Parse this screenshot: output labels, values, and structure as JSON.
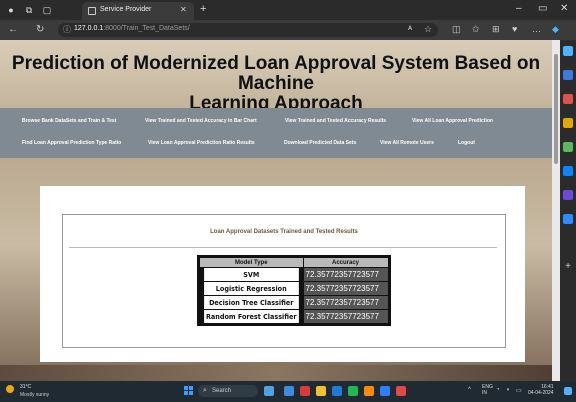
{
  "browser": {
    "tab_title": "Service Provider",
    "url_host": "127.0.0.1",
    "url_path": ":8000/Train_Test_DataSets/"
  },
  "site": {
    "title_line1": "Prediction of Modernized Loan Approval System Based on Machine",
    "title_line2": "Learning Approach"
  },
  "menu": {
    "row1": [
      "Browse Bank DataSets and Train & Test",
      "View Trained and Tested Accuracy in Bar Chart",
      "View Trained and Tested Accuracy Results",
      "View All Loan Approval Prediction"
    ],
    "row2": [
      "Find Loan Approval Prediction Type Ratio",
      "View Loan Approval Prediction Ratio Results",
      "Download Predicted Data Sets",
      "View All Remote Users",
      "Logout"
    ]
  },
  "panel": {
    "title": "Loan Approval Datasets Trained and Tested Results"
  },
  "table": {
    "headers": [
      "Model Type",
      "Accuracy"
    ],
    "rows": [
      {
        "model": "SVM",
        "accuracy": "72.35772357723577"
      },
      {
        "model": "Logistic Regression",
        "accuracy": "72.35772357723577"
      },
      {
        "model": "Decision Tree Classifier",
        "accuracy": "72.35772357723577"
      },
      {
        "model": "Random Forest Classifier",
        "accuracy": "72.35772357723577"
      }
    ]
  },
  "taskbar": {
    "weather_temp": "31°C",
    "weather_desc": "Mostly sunny",
    "search_placeholder": "Search",
    "lang_line1": "ENG",
    "lang_line2": "IN",
    "time": "16:41",
    "date": "04-04-2024"
  },
  "colors": {
    "menu_bg": "#7f8a92",
    "accuracy_cell_bg": "#555555",
    "header_cell_bg": "#b9b9b9"
  },
  "icons": {
    "tab_favicon": "page-icon",
    "back": "back-arrow-icon",
    "reload": "reload-icon",
    "site_info": "info-icon",
    "favorite": "star-icon",
    "start": "windows-start-icon"
  }
}
